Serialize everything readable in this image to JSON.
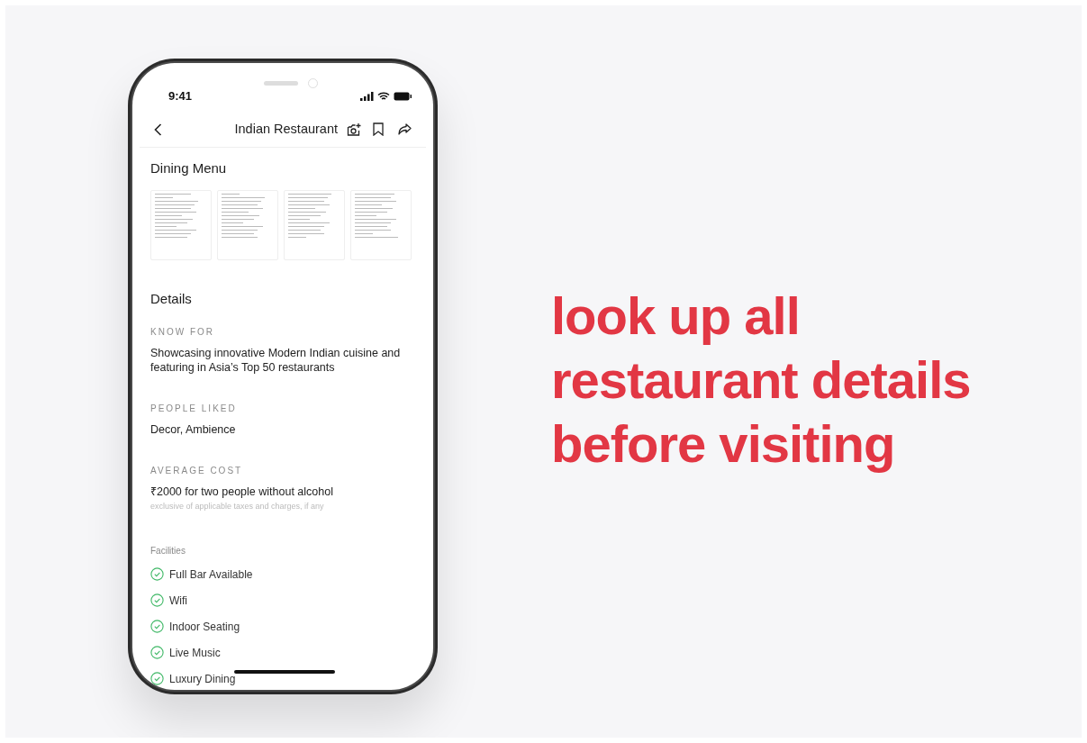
{
  "status_bar": {
    "time": "9:41"
  },
  "header": {
    "title": "Indian Restaurant"
  },
  "dining_menu": {
    "title": "Dining Menu"
  },
  "details": {
    "title": "Details",
    "sections": [
      {
        "label": "KNOW FOR",
        "value": "Showcasing innovative Modern Indian cuisine and featuring in Asia’s Top 50 restaurants"
      },
      {
        "label": "PEOPLE LIKED",
        "value": "Decor, Ambience"
      },
      {
        "label": "AVERAGE COST",
        "value": "₹2000 for two people without alcohol",
        "note": "exclusive of applicable taxes and charges, if any"
      }
    ]
  },
  "facilities": {
    "title": "Facilities",
    "items": [
      {
        "label": "Full Bar Available",
        "available": true
      },
      {
        "label": "Wifi",
        "available": true
      },
      {
        "label": "Indoor Seating",
        "available": true
      },
      {
        "label": "Live Music",
        "available": true
      },
      {
        "label": "Luxury Dining",
        "available": true
      }
    ]
  },
  "headline": [
    "look up all",
    "restaurant details",
    "before visiting"
  ]
}
